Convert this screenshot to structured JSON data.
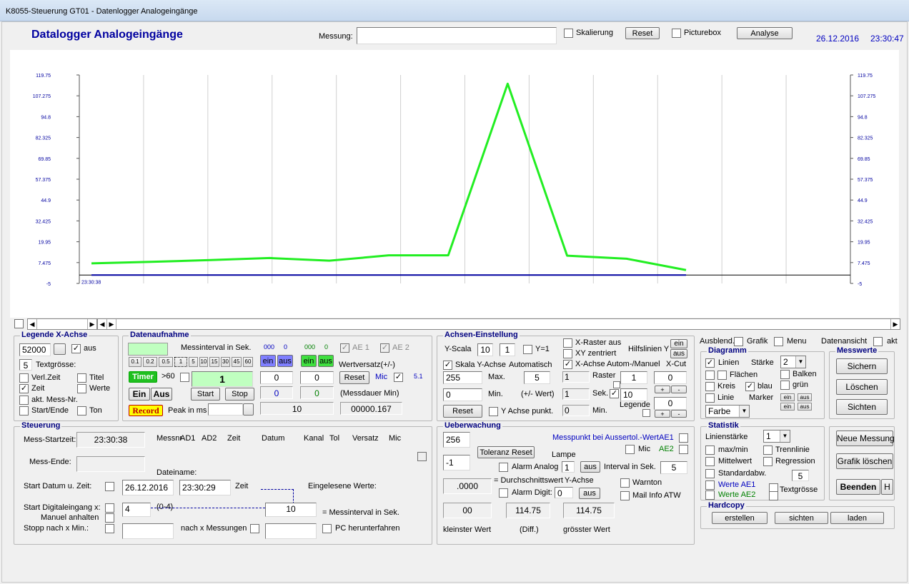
{
  "window": {
    "title": "K8055-Steuerung GT01 - Datenlogger Analogeingänge"
  },
  "header": {
    "app_title": "Datalogger Analogeingänge",
    "messung_label": "Messung:",
    "messung_value": "",
    "skalierung_label": "Skalierung",
    "reset_label": "Reset",
    "picturebox_label": "Picturebox",
    "analyse_label": "Analyse",
    "date": "26.12.2016",
    "time": "23:30:47"
  },
  "colors": {
    "series_ae1": "#22ee22",
    "series_ae2": "#0000a0",
    "title": "#0000a0",
    "group_title": "#000080"
  },
  "chart_data": {
    "type": "line",
    "ylim": [
      -5,
      119.75
    ],
    "yticks": [
      "119.75",
      "107.275",
      "94.8",
      "82.325",
      "69.85",
      "57.375",
      "44.9",
      "32.425",
      "19.95",
      "7.475",
      "-5"
    ],
    "start_label": "23:30:38",
    "grid": true,
    "series": [
      {
        "values": [
          7.0,
          7.9,
          9.0,
          10.2,
          8.6,
          11.8,
          11.8,
          114.5,
          11.6,
          9.8,
          3.0
        ],
        "color": "#22ee22"
      },
      {
        "values": [
          0,
          0,
          0,
          0,
          0,
          0,
          0,
          0,
          0,
          0,
          0
        ],
        "color": "#0000a0"
      }
    ]
  },
  "legende_x": {
    "title": "Legende X-Achse",
    "value": "52000",
    "aus": "aus",
    "textsize": "5",
    "textsize_label": "Textgrösse:",
    "verl_zeit": "Verl.Zeit",
    "titel": "Titel",
    "zeit": "Zeit",
    "werte": "Werte",
    "akt_mess_nr": "akt. Mess-Nr.",
    "start_ende": "Start/Ende",
    "ton": "Ton"
  },
  "datenaufnahme": {
    "title": "Datenaufnahme",
    "messinterval_label": "Messinterval in Sek.",
    "ind1": "000",
    "ind1b": "0",
    "ind2": "000",
    "ind2b": "0",
    "ein": "ein",
    "aus": "aus",
    "ae1": "AE 1",
    "ae2": "AE 2",
    "wertversatz": "Wertversatz(+/-)",
    "intervals": [
      "0.1",
      "0.2",
      "0.5",
      "1",
      "5",
      "10",
      "15",
      "30",
      "45",
      "60"
    ],
    "timer": "Timer",
    "gt60": ">60",
    "interval_value": "1",
    "v1": "0",
    "v2": "0",
    "reset": "Reset",
    "mic": "Mic",
    "mic_val": "5.1",
    "ein_btn": "Ein",
    "aus_btn": "Aus",
    "start": "Start",
    "stop": "Stop",
    "v3": "0",
    "v4": "0",
    "messdauer": "(Messdauer Min)",
    "record": "Record",
    "peak": "Peak in ms",
    "v5": "10",
    "v6": "00000.167"
  },
  "achsen": {
    "title": "Achsen-Einstellung",
    "yscala": "Y-Scala",
    "ys1": "10",
    "ys2": "1",
    "y1": "Y=1",
    "xraster": "X-Raster aus",
    "xy_zentriert": "XY zentriert",
    "hilfslinien": "Hilfslinien Y",
    "ein": "ein",
    "aus": "aus",
    "skala_y": "Skala Y-Achse",
    "automatisch": "Automatisch",
    "x_autom": "X-Achse Autom-/Manuel",
    "xcut": "X-Cut",
    "max_val": "255",
    "max": "Max.",
    "plus_val": "5",
    "r1": "1",
    "raster": "Raster",
    "raster_val": "1",
    "xcut_val": "0",
    "min_val": "0",
    "min": "Min.",
    "plusminus": "(+/- Wert)",
    "r2": "1",
    "sek": "Sek.",
    "sek_val": "10",
    "plus": "+",
    "minus": "-",
    "reset": "Reset",
    "y_punkt": "Y Achse punkt.",
    "r3": "0",
    "min2": "Min.",
    "legende": "Legende",
    "legende_val": "0"
  },
  "right": {
    "ausblend": "Ausblend.",
    "grafik": "Grafik",
    "menu": "Menu",
    "datenansicht": "Datenansicht",
    "akt": "akt",
    "diagramm": "Diagramm",
    "linien": "Linien",
    "staerke": "Stärke",
    "staerke_val": "2",
    "flaechen": "Flächen",
    "balken": "Balken",
    "kreis": "Kreis",
    "blau": "blau",
    "gruen": "grün",
    "linie": "Linie",
    "marker": "Marker",
    "ein": "ein",
    "aus": "aus",
    "farbe": "Farbe",
    "messwerte": "Messwerte",
    "sichern": "Sichern",
    "loeschen": "Löschen",
    "sichten": "Sichten",
    "statistik": "Statistik",
    "linienstaerke": "Linienstärke",
    "linienstaerke_val": "1",
    "maxmin": "max/min",
    "trennlinie": "Trennlinie",
    "mittelwert": "Mittelwert",
    "regression": "Regression",
    "standardabw": "Standardabw.",
    "std_val": "5",
    "werte_ae1": "Werte AE1",
    "werte_ae2": "Werte AE2",
    "textgroesse": "Textgrösse",
    "neue_messung": "Neue Messung",
    "grafik_loeschen": "Grafik löschen",
    "beenden": "Beenden",
    "h": "H",
    "hardcopy": "Hardcopy",
    "erstellen": "erstellen",
    "hc_sichten": "sichten",
    "laden": "laden"
  },
  "steuerung": {
    "title": "Steuerung",
    "mess_startzeit": "Mess-Startzeit:",
    "startzeit_val": "23:30:38",
    "cols": [
      "Messnr",
      "AD1",
      "AD2",
      "Zeit",
      "Datum",
      "Kanal",
      "Tol",
      "Versatz",
      "Mic"
    ],
    "mess_ende": "Mess-Ende:",
    "dateiname": "Dateiname:",
    "start_datum": "Start Datum u. Zeit:",
    "datum_val": "26.12.2016",
    "zeit_val": "23:30:29",
    "zeit": "Zeit",
    "eingelesene": "Eingelesene Werte:",
    "start_digital": "Start Digitaleingang x:",
    "dig_val": "4",
    "range": "(0-4)",
    "interval_val": "10",
    "messinterval": "= Messinterval in Sek.",
    "manuel": "Manuel anhalten",
    "stopp": "Stopp nach x Min.:",
    "nach_x": "nach x Messungen",
    "pc_herunter": "PC herunterfahren"
  },
  "ueberwachung": {
    "title": "Ueberwachung",
    "val1": "256",
    "messpunkt": "Messpunkt bei Aussertol.-Wert",
    "ae1": "AE1",
    "toleranz": "Toleranz Reset",
    "mic": "Mic",
    "ae2": "AE2",
    "val2": "-1",
    "lampe": "Lampe",
    "alarm_analog": "Alarm Analog",
    "lampe_val": "1",
    "aus": "aus",
    "interval_sek": "Interval in Sek.",
    "interval_val": "5",
    "avg": ".0000",
    "durchschnitt": "= Durchschnittswert",
    "y_achse": "Y-Achse",
    "warnton": "Warnton",
    "alarm_digit": "Alarm Digit:",
    "digit_val": "0",
    "mail": "Mail Info ATW",
    "min_val": "00",
    "diff_val": "114.75",
    "max_val": "114.75",
    "kleinster": "kleinster Wert",
    "diff": "(Diff.)",
    "groesster": "grösster Wert"
  }
}
